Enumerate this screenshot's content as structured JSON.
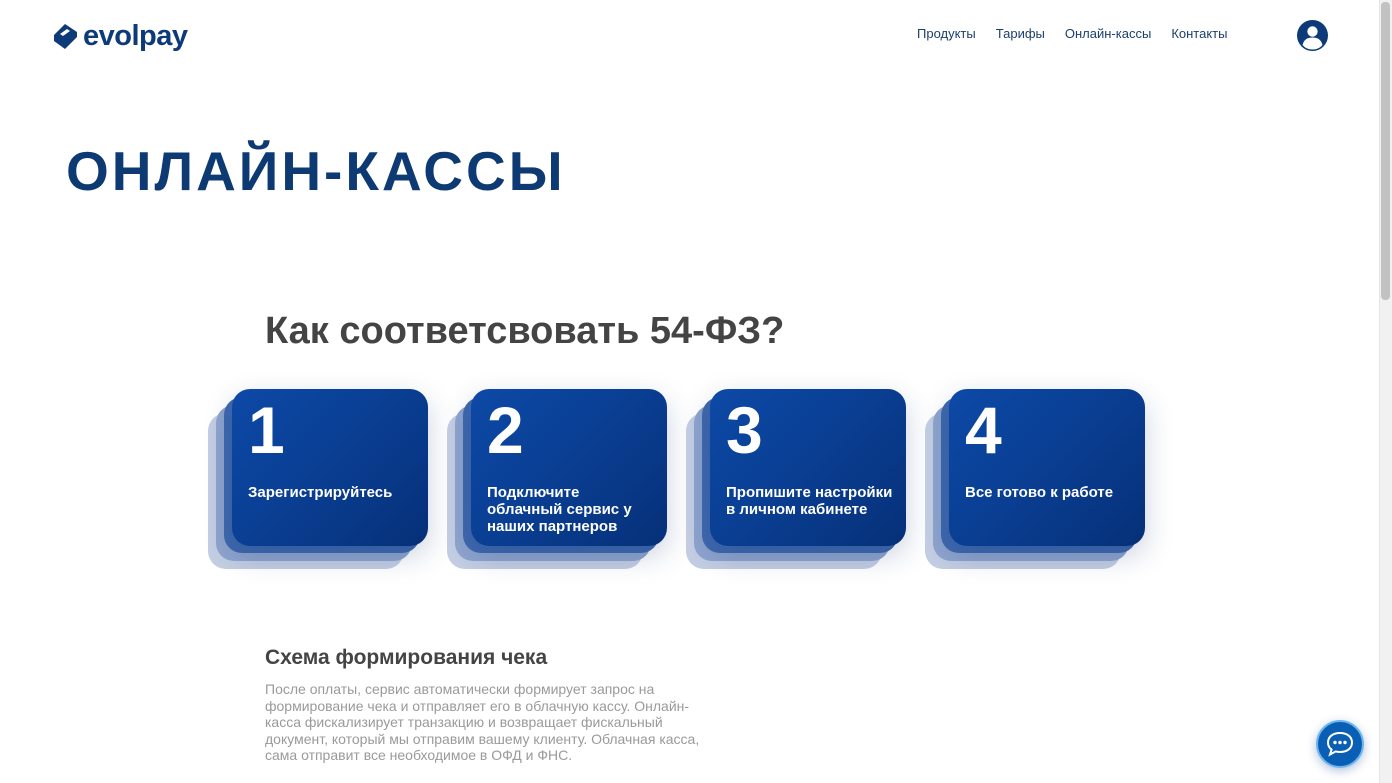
{
  "header": {
    "brand": "evolpay",
    "nav": [
      "Продукты",
      "Тарифы",
      "Онлайн-кассы",
      "Контакты"
    ]
  },
  "hero": {
    "title": "ОНЛАЙН-КАССЫ"
  },
  "compliance": {
    "title": "Как соответсвовать 54-ФЗ?",
    "steps": [
      {
        "number": "1",
        "label": "Зарегистрируйтесь"
      },
      {
        "number": "2",
        "label": "Подключите облачный сервис у наших партнеров"
      },
      {
        "number": "3",
        "label": "Пропишите настройки в личном кабинете"
      },
      {
        "number": "4",
        "label": "Все готово к работе"
      }
    ]
  },
  "scheme": {
    "title": "Схема формирования чека",
    "text": "После оплаты, сервис автоматически формирует запрос на формирование чека и отправляет его в облачную кассу. Онлайн-касса фискализирует транзакцию и возвращает фискальный документ, который мы отправим вашему клиенту. Облачная касса, сама отправит все необходимое в ОФД и ФНС."
  },
  "colors": {
    "brand": "#0d3b7a",
    "card_gradient_start": "#0c49a6",
    "card_gradient_end": "#063078",
    "chat_button": "#0a5fb4"
  },
  "icons": {
    "logo": "evolpay-logo-icon",
    "account": "user-avatar-icon",
    "chat": "chat-bubble-icon"
  }
}
